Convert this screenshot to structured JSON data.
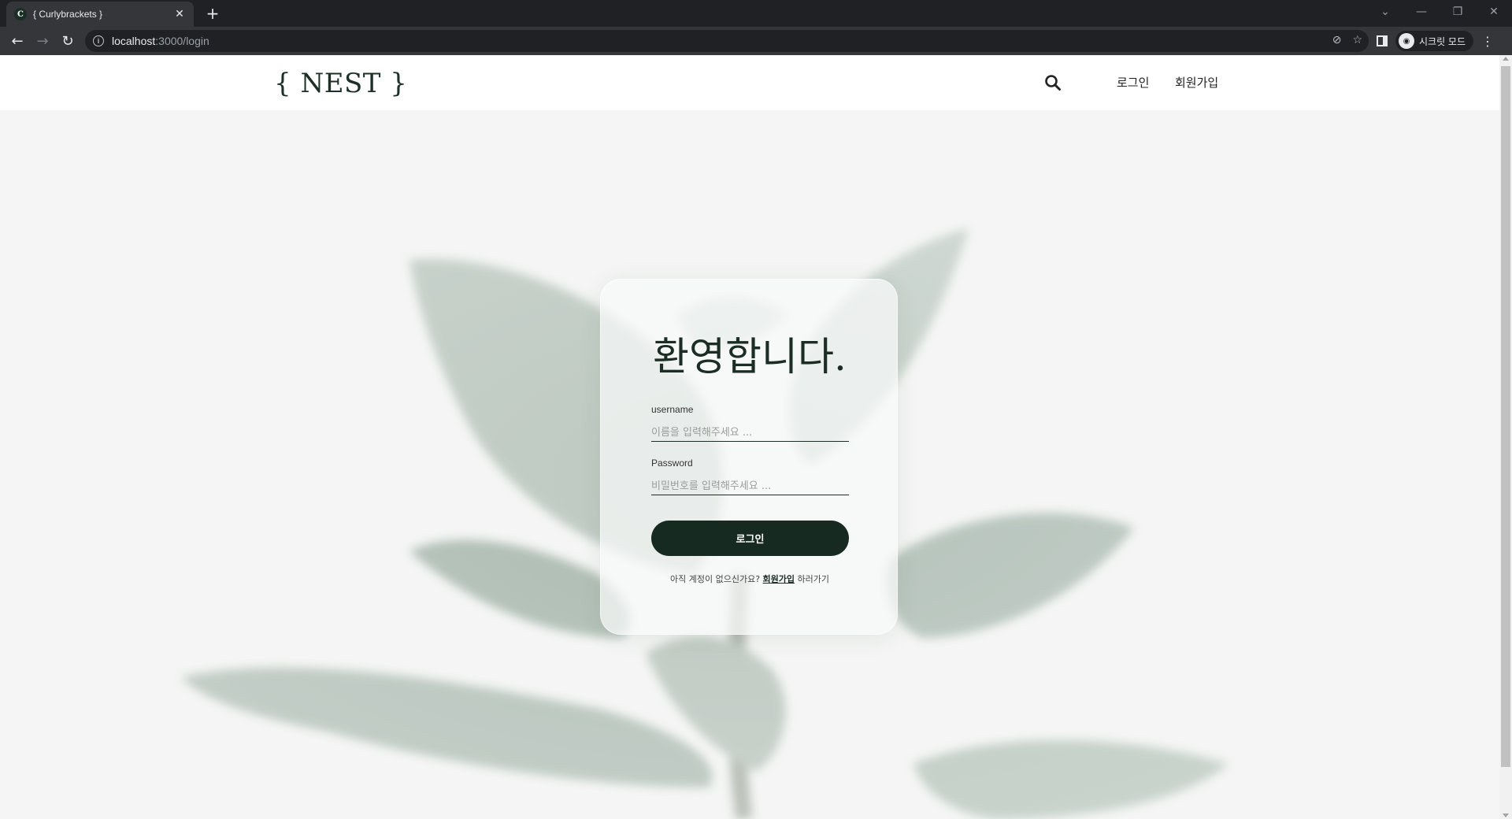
{
  "browser": {
    "tab_title": "{ Curlybrackets }",
    "tab_favicon": "C",
    "url_host": "localhost",
    "url_path": ":3000/login",
    "incognito_label": "시크릿 모드"
  },
  "header": {
    "logo": "{ NEST }",
    "nav": {
      "login": "로그인",
      "signup": "회원가입"
    }
  },
  "login_form": {
    "title": "환영합니다.",
    "username_label": "username",
    "username_placeholder": "이름을 입력해주세요 ...",
    "password_label": "Password",
    "password_placeholder": "비밀번호를 입력해주세요 ...",
    "submit_label": "로그인",
    "signup_prefix": "아직 계정이 없으신가요?",
    "signup_link": "회원가입",
    "signup_suffix": "하러가기"
  },
  "colors": {
    "brand": "#1b2d25",
    "button": "#172a21",
    "background": "#f4f5f4"
  },
  "icons": [
    "back-icon",
    "forward-icon",
    "reload-icon",
    "info-icon",
    "eye-off-icon",
    "star-icon",
    "side-panel-icon",
    "incognito-icon",
    "menu-icon",
    "search-icon"
  ]
}
